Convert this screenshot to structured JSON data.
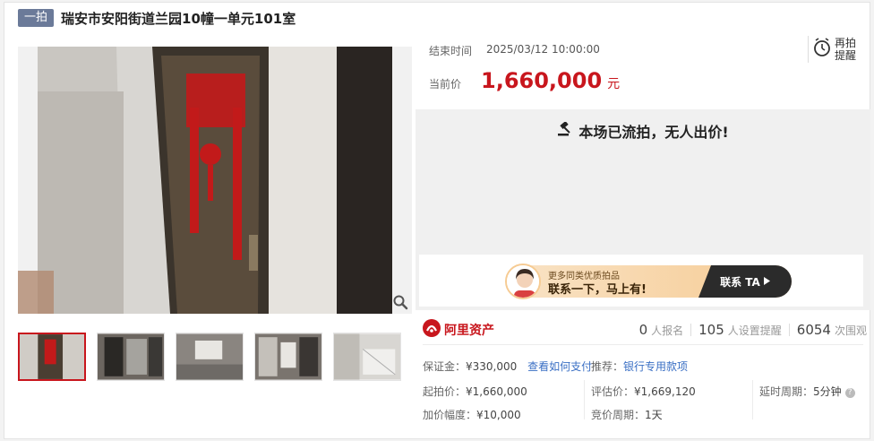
{
  "header": {
    "round_tag": "一拍",
    "title": "瑞安市安阳街道兰园10幢一单元101室"
  },
  "auction": {
    "end_time_label": "结束时间",
    "end_time_value": "2025/03/12 10:00:00",
    "price_label": "当前价",
    "price_value": "1,660,000",
    "price_unit": "元",
    "remind_label_1": "再拍",
    "remind_label_2": "提醒",
    "status_message": "本场已流拍，无人出价!"
  },
  "promo": {
    "line1": "更多同类优质拍品",
    "line2": "联系一下，马上有!",
    "cta": "联系 TA"
  },
  "brand": {
    "name": "阿里资产"
  },
  "stats": [
    {
      "value": "0",
      "label": "人报名"
    },
    {
      "value": "105",
      "label": "人设置提醒"
    },
    {
      "value": "6054",
      "label": "次围观"
    }
  ],
  "fields": {
    "deposit_label": "保证金：",
    "deposit_value": "¥330,000",
    "how_to_pay": "查看如何支付",
    "recommend_label": "推荐：",
    "recommend_link": "银行专用款项",
    "start_price_label": "起拍价：",
    "start_price_value": "¥1,660,000",
    "appraisal_label": "评估价：",
    "appraisal_value": "¥1,669,120",
    "delay_label": "延时周期：",
    "delay_value": "5分钟",
    "increment_label": "加价幅度：",
    "increment_value": "¥10,000",
    "bid_period_label": "竞价周期：",
    "bid_period_value": "1天"
  },
  "colors": {
    "accent_red": "#c8161d",
    "tag_bg": "#6b7a99",
    "link_blue": "#3a6fc4"
  },
  "icons": [
    "zoom-icon",
    "alarm-clock-icon",
    "gavel-icon",
    "ali-asset-logo-icon",
    "help-icon",
    "play-arrow-icon"
  ]
}
